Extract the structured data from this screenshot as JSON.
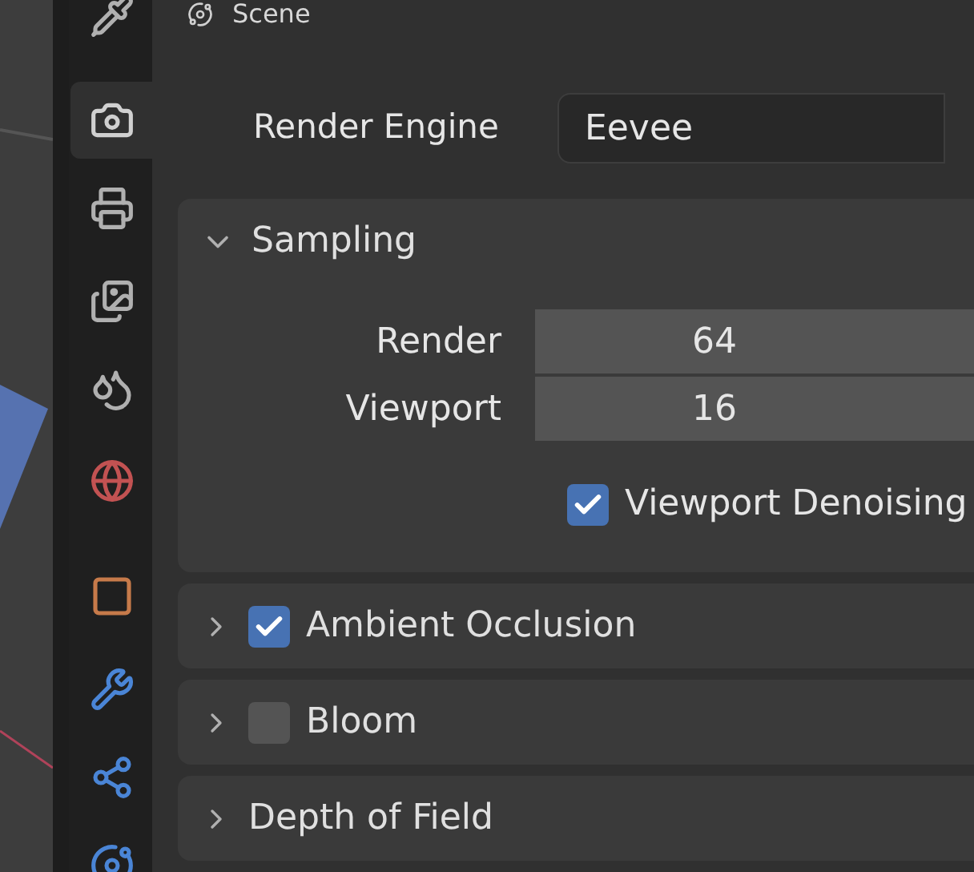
{
  "tabs": [
    {
      "selected": false
    },
    {
      "selected": true
    },
    {
      "selected": false
    },
    {
      "selected": false
    },
    {
      "selected": false
    },
    {
      "selected": false
    },
    {
      "selected": false
    },
    {
      "selected": false
    },
    {
      "selected": false
    },
    {
      "selected": false
    }
  ],
  "header": {
    "title": "Scene"
  },
  "render_engine": {
    "label": "Render Engine",
    "value": "Eevee"
  },
  "panels": [
    {
      "title": "Sampling",
      "expanded": true,
      "checkbox": false,
      "fields": [
        {
          "label": "Render",
          "value": "64"
        },
        {
          "label": "Viewport",
          "value": "16"
        }
      ],
      "options": [
        {
          "label": "Viewport Denoising",
          "checked": true
        }
      ]
    },
    {
      "title": "Ambient Occlusion",
      "expanded": false,
      "checkbox": true,
      "checked": true
    },
    {
      "title": "Bloom",
      "expanded": false,
      "checkbox": true,
      "checked": false
    },
    {
      "title": "Depth of Field",
      "expanded": false,
      "checkbox": false
    }
  ]
}
